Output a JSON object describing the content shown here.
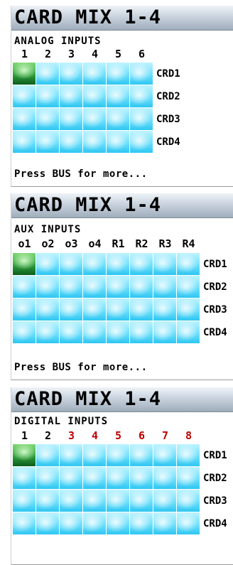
{
  "panels": [
    {
      "title": "CARD MIX 1-4",
      "subtitle": "ANALOG INPUTS",
      "columns": [
        {
          "label": "1",
          "red": false
        },
        {
          "label": "2",
          "red": false
        },
        {
          "label": "3",
          "red": false
        },
        {
          "label": "4",
          "red": false
        },
        {
          "label": "5",
          "red": false
        },
        {
          "label": "6",
          "red": false
        }
      ],
      "rows": [
        "CRD1",
        "CRD2",
        "CRD3",
        "CRD4"
      ],
      "active": [
        [
          0,
          0
        ]
      ],
      "footer": "Press BUS for more..."
    },
    {
      "title": "CARD MIX 1-4",
      "subtitle": "AUX INPUTS",
      "columns": [
        {
          "label": "o1",
          "red": false
        },
        {
          "label": "o2",
          "red": false
        },
        {
          "label": "o3",
          "red": false
        },
        {
          "label": "o4",
          "red": false
        },
        {
          "label": "R1",
          "red": false
        },
        {
          "label": "R2",
          "red": false
        },
        {
          "label": "R3",
          "red": false
        },
        {
          "label": "R4",
          "red": false
        }
      ],
      "rows": [
        "CRD1",
        "CRD2",
        "CRD3",
        "CRD4"
      ],
      "active": [
        [
          0,
          0
        ]
      ],
      "footer": "Press BUS for more..."
    },
    {
      "title": "CARD MIX 1-4",
      "subtitle": "DIGITAL INPUTS",
      "columns": [
        {
          "label": "1",
          "red": false
        },
        {
          "label": "2",
          "red": false
        },
        {
          "label": "3",
          "red": true
        },
        {
          "label": "4",
          "red": true
        },
        {
          "label": "5",
          "red": true
        },
        {
          "label": "6",
          "red": true
        },
        {
          "label": "7",
          "red": true
        },
        {
          "label": "8",
          "red": true
        }
      ],
      "rows": [
        "CRD1",
        "CRD2",
        "CRD3",
        "CRD4"
      ],
      "active": [
        [
          0,
          0
        ]
      ],
      "footer": ""
    }
  ]
}
